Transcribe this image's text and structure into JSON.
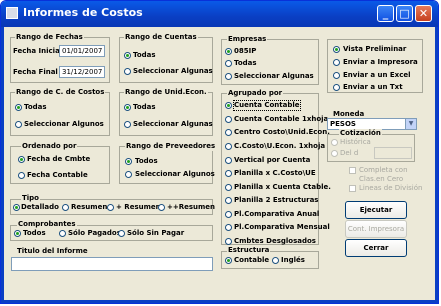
{
  "window": {
    "title": "Informes de Costos",
    "minimize": "_",
    "maximize": "□",
    "close": "✕"
  },
  "fechas": {
    "title": "Rango de Fechas",
    "inicial_label": "Fecha Inicial",
    "inicial_value": "01/01/2007",
    "final_label": "Fecha Final",
    "final_value": "31/12/2007"
  },
  "cuentas": {
    "title": "Rango de Cuentas",
    "todas": "Todas",
    "seleccionar": "Seleccionar Algunas"
  },
  "empresas": {
    "title": "Empresas",
    "options": [
      "085IP",
      "Todas",
      "Seleccionar Algunas"
    ]
  },
  "ccostos": {
    "title": "Rango de C. de Costos",
    "todas": "Todas",
    "seleccionar": "Seleccionar Algunos"
  },
  "unid": {
    "title": "Rango de Unid.Econ.",
    "todas": "Todas",
    "seleccionar": "Seleccionar Algunas"
  },
  "agrupado": {
    "title": "Agrupado por",
    "options": [
      "Cuenta Contable",
      "Cuenta Contable 1xhoja",
      "Centro Costo\\Unid.Econ.",
      "C.Costo\\U.Econ. 1xhoja",
      "Vertical por Cuenta",
      "Planilla x C.Costo\\UE",
      "Planilla x Cuenta Ctable.",
      "Planilla 2 Estructuras",
      "Pl.Comparativa Anual",
      "Pl.Comparativa Mensual",
      "Cmbtes Desglosados"
    ]
  },
  "ordenado": {
    "title": "Ordenado por",
    "options": [
      "Fecha de Cmbte",
      "Fecha Contable"
    ]
  },
  "proveedores": {
    "title": "Rango de Preveedores",
    "todos": "Todos",
    "seleccionar": "Seleccionar Algunos"
  },
  "tipo": {
    "title": "Tipo",
    "options": [
      "Detallado",
      "Resumen",
      "+ Resumen",
      "++Resumen"
    ]
  },
  "comprobantes": {
    "title": "Comprobantes",
    "options": [
      "Todos",
      "Sólo Pagados",
      "Sólo Sin Pagar"
    ]
  },
  "titulo": {
    "label": "Titulo del Informe",
    "value": ""
  },
  "estructura": {
    "title": "Estructura",
    "options": [
      "Contable",
      "Inglés"
    ]
  },
  "salida": {
    "options": [
      "Vista Preliminar",
      "Enviar a Impresora",
      "Enviar a un Excel",
      "Enviar a un Txt"
    ]
  },
  "moneda": {
    "label": "Moneda",
    "value": "PESOS"
  },
  "cotizacion": {
    "title": "Cotización",
    "historica": "Histórica",
    "dia": "Del d"
  },
  "checks": {
    "clasen_cero": "Completa con Clas.en Cero",
    "lineas": "Lineas de División"
  },
  "buttons": {
    "ejecutar": "Ejecutar",
    "cont_impresora": "Cont. Impresora",
    "cerrar": "Cerrar"
  }
}
